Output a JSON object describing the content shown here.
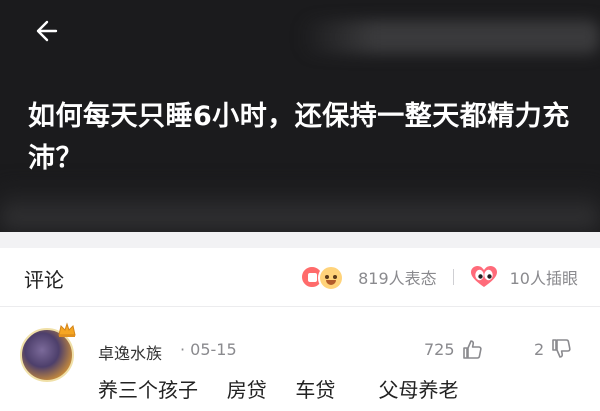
{
  "header": {
    "question_title": "如何每天只睡6小时，还保持一整天都精力充沛？"
  },
  "comments_section": {
    "label": "评论",
    "reactions_count": "819人表态",
    "eyeroll_count": "10人插眼"
  },
  "comment": {
    "username": "卓逸水族",
    "date": "· 05-15",
    "likes": "725",
    "dislikes": "2",
    "text": "养三个孩子  房贷  车贷   父母养老"
  },
  "colors": {
    "header_bg": "#1b1b1d",
    "accent_red": "#ff6b6b",
    "text_secondary": "#8a8a8e"
  },
  "icons": [
    "back-arrow-icon",
    "heart-emoji-icon",
    "laugh-cry-emoji-icon",
    "eyes-icon",
    "crown-icon",
    "thumbs-up-icon",
    "thumbs-down-icon"
  ]
}
